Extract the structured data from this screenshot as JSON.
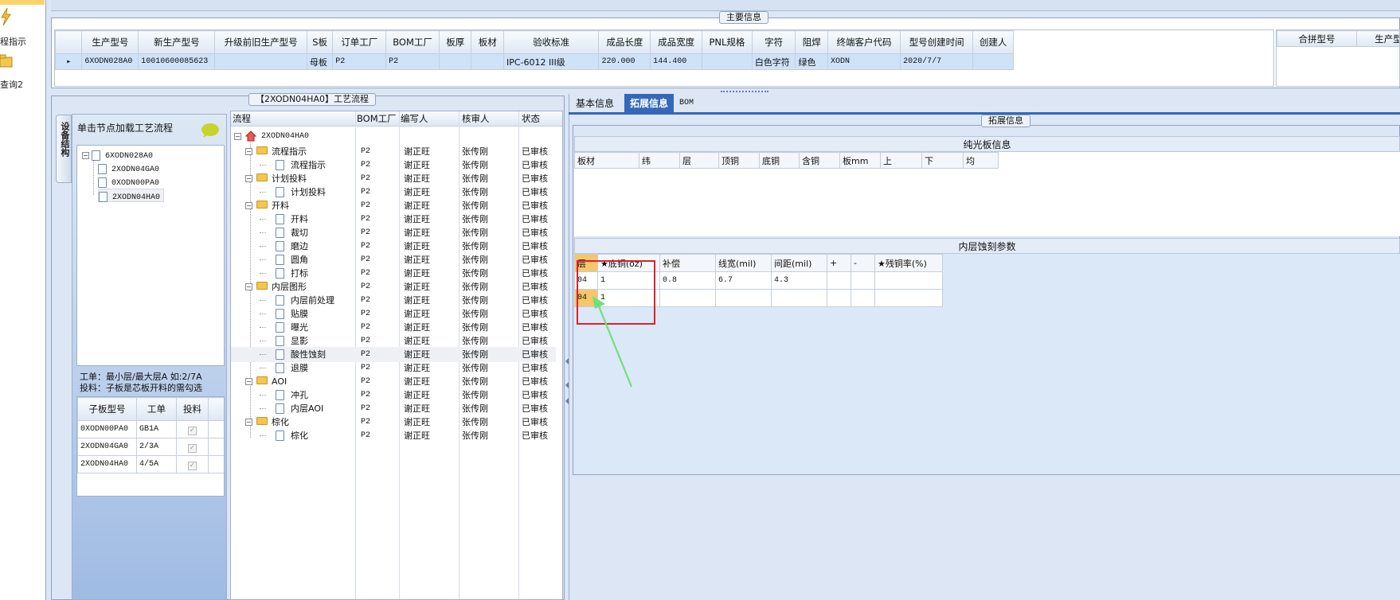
{
  "left_nav": {
    "item1_label": "程指示",
    "item2_label": "查询2"
  },
  "main_info": {
    "title": "主要信息",
    "columns": [
      "生产型号",
      "新生产型号",
      "升级前旧生产型号",
      "S板",
      "订单工厂",
      "BOM工厂",
      "板厚",
      "板材",
      "验收标准",
      "成品长度",
      "成品宽度",
      "PNL规格",
      "字符",
      "阻焊",
      "终端客户代码",
      "型号创建时间",
      "创建人"
    ],
    "row": [
      "6XODN028A0",
      "10010600085623",
      "",
      "母板",
      "P2",
      "P2",
      "",
      "",
      "IPC-6012 III级",
      "220.000",
      "144.400",
      "",
      "白色字符",
      "绿色",
      "XODN",
      "2020/7/7",
      ""
    ],
    "merge_cols": [
      "合拼型号",
      "生产型"
    ]
  },
  "process": {
    "title": "【2XODN04HA0】工艺流程",
    "side_tab": "设备结构",
    "hint": "单击节点加载工艺流程",
    "tree": [
      "6XODN028A0",
      "2XODN04GA0",
      "0XODN00PA0",
      "2XODN04HA0"
    ],
    "note_line1": "工单：最小层/最大层A 如:2/7A",
    "note_line2": "投料：子板是芯板开料的需勾选",
    "sub_cols": [
      "子板型号",
      "工单",
      "投料"
    ],
    "sub_rows": [
      [
        "0XODN00PA0",
        "GB1A",
        "✓"
      ],
      [
        "2XODN04GA0",
        "2/3A",
        "✓"
      ],
      [
        "2XODN04HA0",
        "4/5A",
        "✓"
      ]
    ],
    "flow_cols": [
      "流程",
      "BOM工厂",
      "编写人",
      "核审人",
      "状态"
    ],
    "root": "2XODN04HA0",
    "rows": [
      {
        "name": "流程指示",
        "folder": true,
        "bom": "P2",
        "writer": "谢正旺",
        "reviewer": "张传刚",
        "status": "已审核"
      },
      {
        "name": "流程指示",
        "folder": false,
        "bom": "P2",
        "writer": "谢正旺",
        "reviewer": "张传刚",
        "status": "已审核"
      },
      {
        "name": "计划投料",
        "folder": true,
        "bom": "P2",
        "writer": "谢正旺",
        "reviewer": "张传刚",
        "status": "已审核"
      },
      {
        "name": "计划投料",
        "folder": false,
        "bom": "P2",
        "writer": "谢正旺",
        "reviewer": "张传刚",
        "status": "已审核"
      },
      {
        "name": "开料",
        "folder": true,
        "bom": "P2",
        "writer": "谢正旺",
        "reviewer": "张传刚",
        "status": "已审核"
      },
      {
        "name": "开料",
        "folder": false,
        "bom": "P2",
        "writer": "谢正旺",
        "reviewer": "张传刚",
        "status": "已审核"
      },
      {
        "name": "裁切",
        "folder": false,
        "bom": "P2",
        "writer": "谢正旺",
        "reviewer": "张传刚",
        "status": "已审核"
      },
      {
        "name": "磨边",
        "folder": false,
        "bom": "P2",
        "writer": "谢正旺",
        "reviewer": "张传刚",
        "status": "已审核"
      },
      {
        "name": "圆角",
        "folder": false,
        "bom": "P2",
        "writer": "谢正旺",
        "reviewer": "张传刚",
        "status": "已审核"
      },
      {
        "name": "打标",
        "folder": false,
        "bom": "P2",
        "writer": "谢正旺",
        "reviewer": "张传刚",
        "status": "已审核"
      },
      {
        "name": "内层图形",
        "folder": true,
        "bom": "P2",
        "writer": "谢正旺",
        "reviewer": "张传刚",
        "status": "已审核"
      },
      {
        "name": "内层前处理",
        "folder": false,
        "bom": "P2",
        "writer": "谢正旺",
        "reviewer": "张传刚",
        "status": "已审核"
      },
      {
        "name": "贴膜",
        "folder": false,
        "bom": "P2",
        "writer": "谢正旺",
        "reviewer": "张传刚",
        "status": "已审核"
      },
      {
        "name": "曝光",
        "folder": false,
        "bom": "P2",
        "writer": "谢正旺",
        "reviewer": "张传刚",
        "status": "已审核"
      },
      {
        "name": "显影",
        "folder": false,
        "bom": "P2",
        "writer": "谢正旺",
        "reviewer": "张传刚",
        "status": "已审核"
      },
      {
        "name": "酸性蚀刻",
        "folder": false,
        "bom": "P2",
        "writer": "谢正旺",
        "reviewer": "张传刚",
        "status": "已审核",
        "selected": true
      },
      {
        "name": "退膜",
        "folder": false,
        "bom": "P2",
        "writer": "谢正旺",
        "reviewer": "张传刚",
        "status": "已审核"
      },
      {
        "name": "AOI",
        "folder": true,
        "bom": "P2",
        "writer": "谢正旺",
        "reviewer": "张传刚",
        "status": "已审核"
      },
      {
        "name": "冲孔",
        "folder": false,
        "bom": "P2",
        "writer": "谢正旺",
        "reviewer": "张传刚",
        "status": "已审核"
      },
      {
        "name": "内层AOI",
        "folder": false,
        "bom": "P2",
        "writer": "谢正旺",
        "reviewer": "张传刚",
        "status": "已审核"
      },
      {
        "name": "棕化",
        "folder": true,
        "bom": "P2",
        "writer": "谢正旺",
        "reviewer": "张传刚",
        "status": "已审核"
      },
      {
        "name": "棕化",
        "folder": false,
        "bom": "P2",
        "writer": "谢正旺",
        "reviewer": "张传刚",
        "status": "已审核"
      }
    ]
  },
  "right": {
    "tabs": [
      "基本信息",
      "拓展信息",
      "BOM"
    ],
    "group_title": "拓展信息",
    "plain_title": "纯光板信息",
    "plain_cols": [
      "板材",
      "纬",
      "层",
      "顶铜",
      "底铜",
      "含铜",
      "板mm",
      "上",
      "下",
      "均"
    ],
    "etch_title": "内层蚀刻参数",
    "etch_cols": [
      "层",
      "★底铜(oz)",
      "补偿",
      "线宽(mil)",
      "间距(mil)",
      "+",
      "-",
      "★残铜率(%)"
    ],
    "etch_rows": [
      [
        "04",
        "1",
        "0.8",
        "6.7",
        "4.3",
        "",
        "",
        ""
      ],
      [
        "04",
        "1",
        "",
        "",
        "",
        "",
        "",
        ""
      ]
    ]
  },
  "colors": {
    "highlight_box": "#e0202a",
    "arrow": "#6fe07a",
    "tab_active": "#3568b8",
    "selected_row": "#cfe2f8"
  }
}
